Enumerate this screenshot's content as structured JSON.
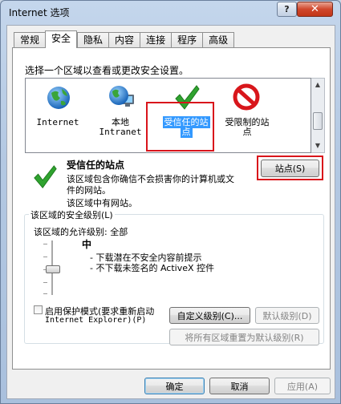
{
  "window": {
    "title": "Internet 选项",
    "help": "?",
    "close": "✕"
  },
  "tabs": [
    "常规",
    "安全",
    "隐私",
    "内容",
    "连接",
    "程序",
    "高级"
  ],
  "active_tab": "安全",
  "zone_prompt": "选择一个区域以查看或更改安全设置。",
  "zones": [
    {
      "line1": "Internet",
      "line2": "",
      "icon": "globe-icon"
    },
    {
      "line1": "本地",
      "line2": "Intranet",
      "icon": "intranet-globe-icon"
    },
    {
      "line1": "受信任的站",
      "line2": "点",
      "icon": "checkmark-icon"
    },
    {
      "line1": "受限制的站",
      "line2": "点",
      "icon": "restricted-icon"
    }
  ],
  "selected_zone": {
    "title": "受信任的站点",
    "desc_line1": "该区域包含你确信不会损害你的计算机或文",
    "desc_line2": "件的网站。",
    "has_sites": "该区域中有网站。",
    "sites_button": "站点(S)"
  },
  "security_level": {
    "group_label": "该区域的安全级别(L)",
    "allowed_label": "该区域的允许级别: 全部",
    "level": "中",
    "bullet1": "- 下载潜在不安全内容前提示",
    "bullet2": "- 不下载未签名的 ActiveX 控件"
  },
  "protected_mode": {
    "label_line1": "启用保护模式(要求重新启动",
    "label_line2": "Internet Explorer)(P)",
    "checked": false
  },
  "buttons": {
    "custom_level": "自定义级别(C)...",
    "default_level": "默认级别(D)",
    "reset_all": "将所有区域重置为默认级别(R)",
    "ok": "确定",
    "cancel": "取消",
    "apply": "应用(A)"
  },
  "colors": {
    "selection": "#3399ff",
    "highlight_box": "#d9141b",
    "check_green": "#2fa32f",
    "restricted_red": "#d8161b"
  }
}
